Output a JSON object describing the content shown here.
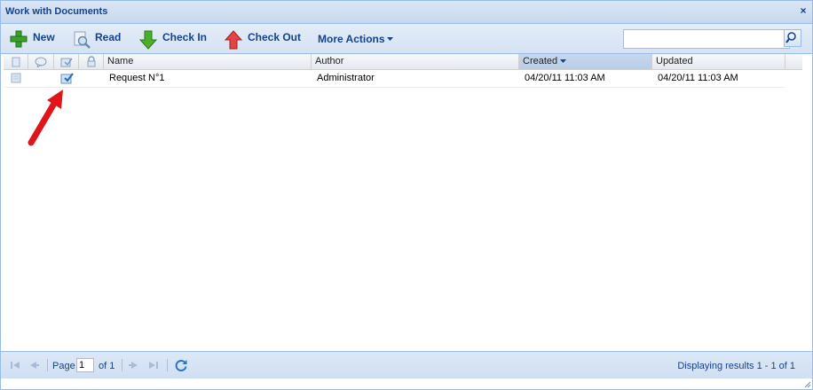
{
  "window": {
    "title": "Work with Documents",
    "close_label": "×"
  },
  "toolbar": {
    "new_label": "New",
    "read_label": "Read",
    "checkin_label": "Check In",
    "checkout_label": "Check Out",
    "more_label": "More Actions",
    "search_value": ""
  },
  "grid": {
    "columns": [
      "Name",
      "Author",
      "Created",
      "Updated"
    ],
    "sorted_column": "Created",
    "rows": [
      {
        "name": "Request N°1",
        "author": "Administrator",
        "created": "04/20/11 11:03 AM",
        "updated": "04/20/11 11:03 AM"
      }
    ]
  },
  "pager": {
    "page_label": "Page",
    "page_value": "1",
    "of_label": "of 1",
    "status": "Displaying results 1 - 1 of 1"
  },
  "annotation": {
    "arrow_color": "#e0141b"
  },
  "colors": {
    "accent": "#15428b",
    "border": "#99bbe8"
  }
}
